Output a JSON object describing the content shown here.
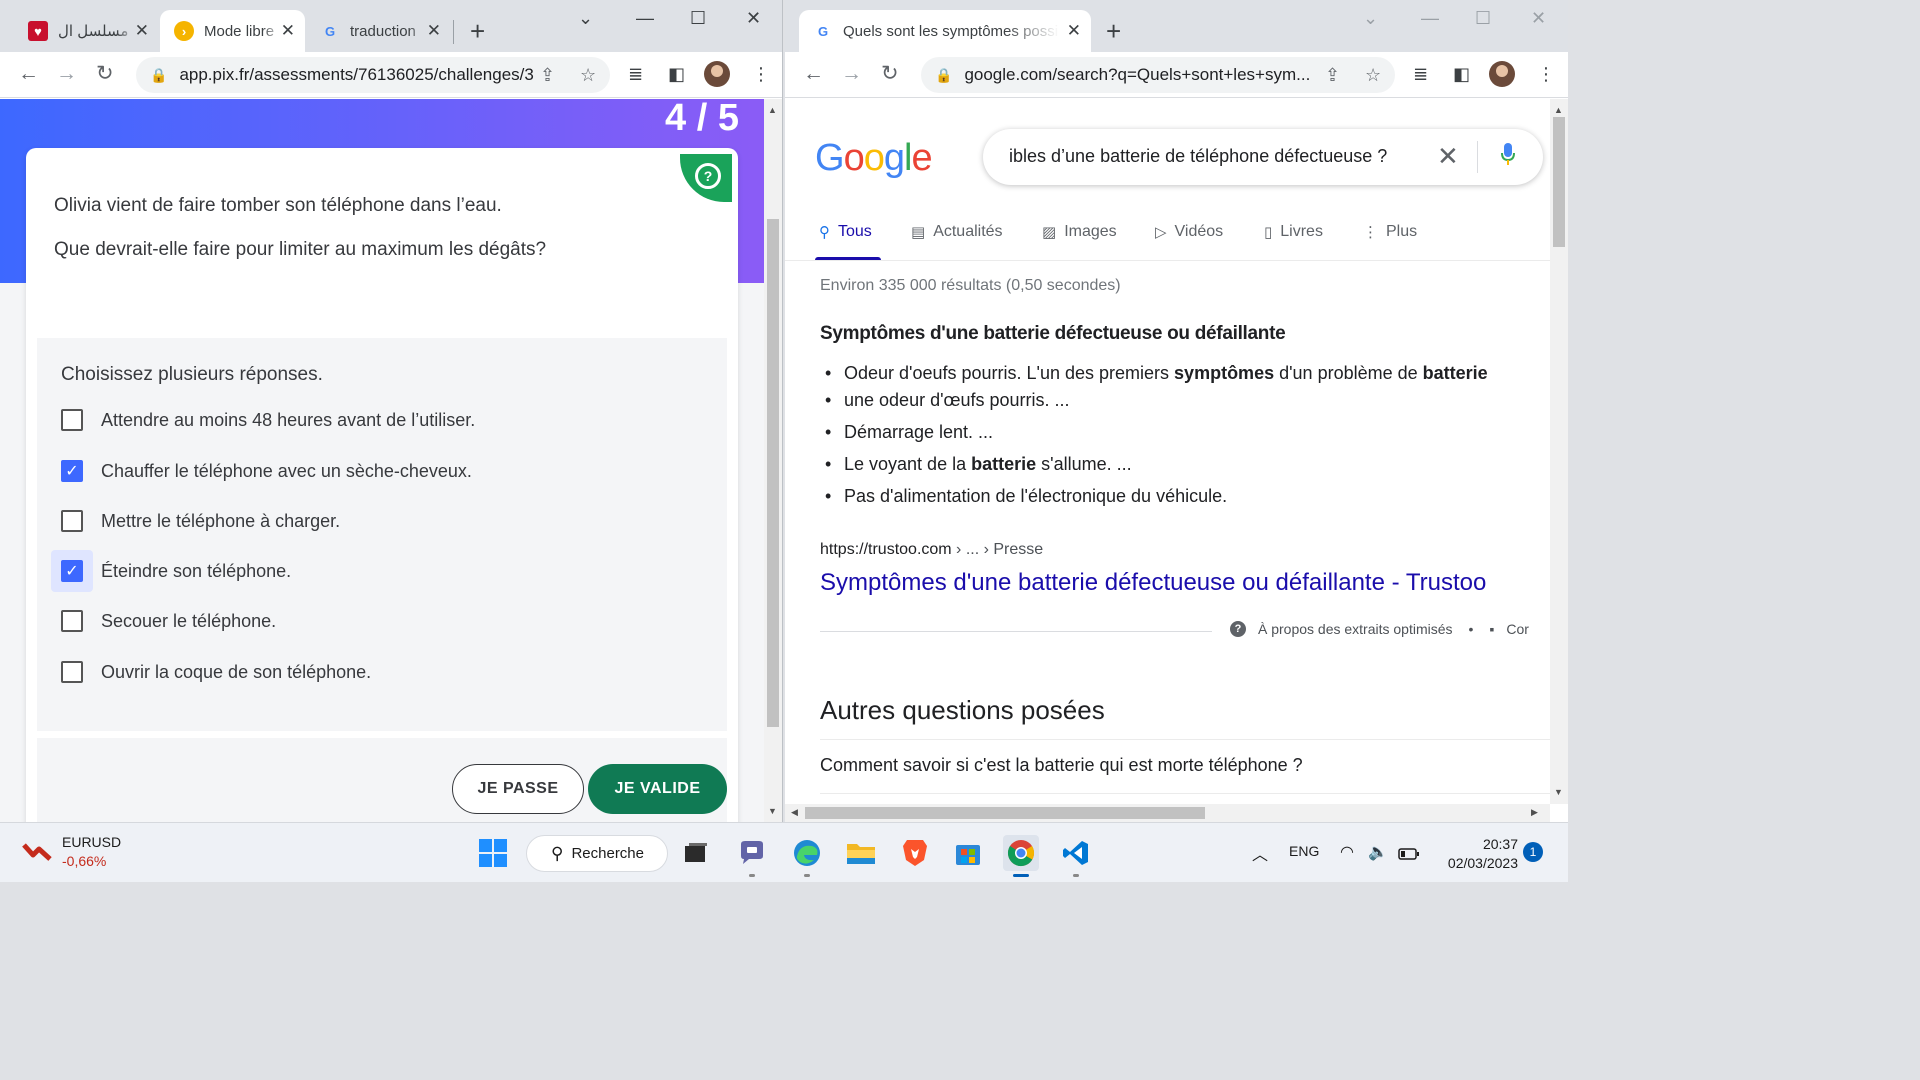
{
  "left_browser": {
    "tabs": [
      {
        "title": "مسلسل ال",
        "active": false
      },
      {
        "title": "Mode libre",
        "active": true
      },
      {
        "title": "traduction",
        "active": false
      }
    ],
    "url": "app.pix.fr/assessments/76136025/challenges/3"
  },
  "pix": {
    "counter": "4 / 5",
    "question_line1": "Olivia vient de faire tomber son téléphone dans l’eau.",
    "question_line2": "Que devrait-elle faire pour limiter au maximum les dégâts?",
    "instruction": "Choisissez plusieurs réponses.",
    "options": [
      {
        "label": "Attendre au moins 48 heures avant de l’utiliser.",
        "checked": false
      },
      {
        "label": "Chauffer le téléphone avec un sèche-cheveux.",
        "checked": true
      },
      {
        "label": "Mettre le téléphone à charger.",
        "checked": false
      },
      {
        "label": "Éteindre son téléphone.",
        "checked": true
      },
      {
        "label": "Secouer le téléphone.",
        "checked": false
      },
      {
        "label": "Ouvrir la coque de son téléphone.",
        "checked": false
      }
    ],
    "skip_label": "JE PASSE",
    "validate_label": "JE VALIDE"
  },
  "right_browser": {
    "tab_title": "Quels sont les symptômes possibles",
    "url": "google.com/search?q=Quels+sont+les+sym..."
  },
  "google": {
    "logo": [
      "G",
      "o",
      "o",
      "g",
      "l",
      "e"
    ],
    "query": "ibles d’une batterie de téléphone défectueuse ?",
    "tabs": [
      "Tous",
      "Actualités",
      "Images",
      "Vidéos",
      "Livres",
      "Plus"
    ],
    "stats": "Environ 335 000 résultats (0,50 secondes)",
    "snippet_title": "Symptômes d'une batterie défectueuse ou défaillante",
    "bullets": {
      "b1_a": "Odeur d'oeufs pourris. L'un des premiers ",
      "b1_b": "symptômes",
      "b1_c": " d'un problème de ",
      "b1_d": "batterie",
      "b1_line2": "une odeur d'œufs pourris. ...",
      "b2": "Démarrage lent. ...",
      "b3_a": "Le voyant de la ",
      "b3_b": "batterie",
      "b3_c": " s'allume. ...",
      "b4": "Pas d'alimentation de l'électronique du véhicule."
    },
    "cite_url": "https://trustoo.com",
    "cite_crumb": " › ... › Presse",
    "result_title": "Symptômes d'une batterie défectueuse ou défaillante - Trustoo",
    "about_snippets": "À propos des extraits optimisés",
    "about_dot": "•",
    "about_feedback": "Cor",
    "paa_title": "Autres questions posées",
    "paa_q1": "Comment savoir si c'est la batterie qui est morte téléphone ?"
  },
  "taskbar": {
    "widget_name": "EURUSD",
    "widget_change": "-0,66%",
    "search_label": "Recherche",
    "lang": "ENG",
    "time": "20:37",
    "date": "02/03/2023",
    "notifications": "1"
  },
  "colors": {
    "pix_blue": "#3d68ff",
    "pix_purple": "#8b5cf6",
    "pix_green": "#107a54",
    "google_link": "#1a0dab"
  }
}
